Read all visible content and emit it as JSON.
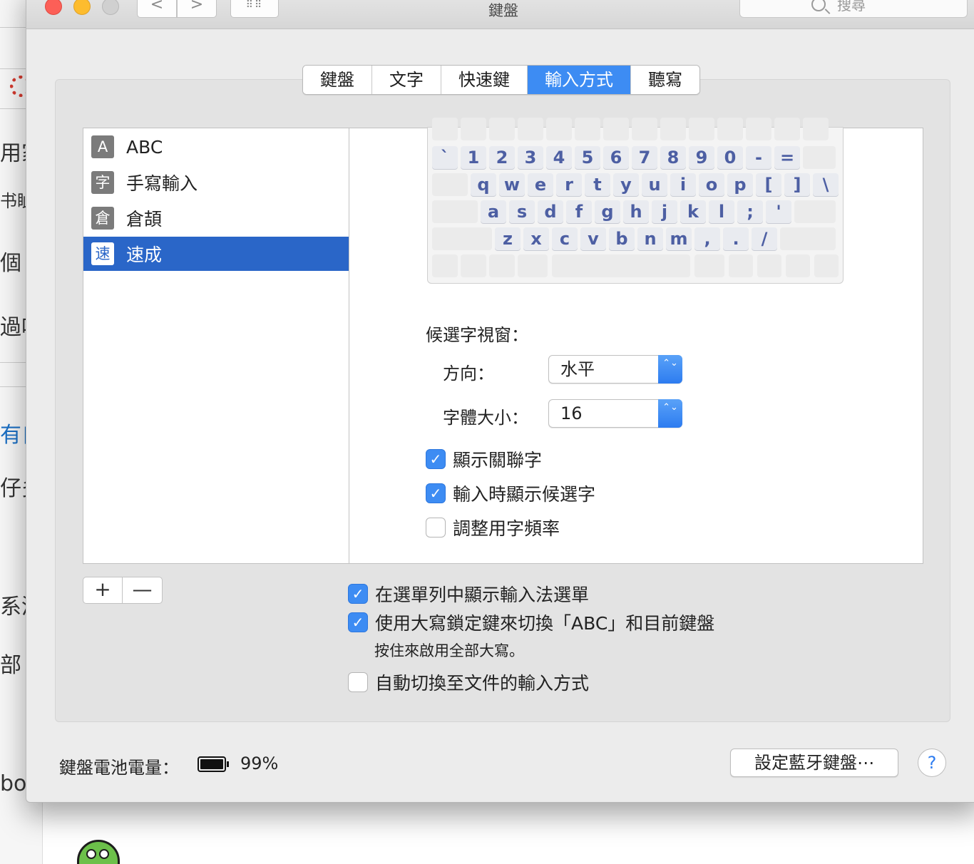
{
  "window": {
    "title": "鍵盤"
  },
  "toolbar": {
    "back_glyph": "<",
    "forward_glyph": ">",
    "grid_glyph": "⠿⠿",
    "search_placeholder": "搜尋"
  },
  "tabs": [
    {
      "label": "鍵盤"
    },
    {
      "label": "文字"
    },
    {
      "label": "快速鍵"
    },
    {
      "label": "輸入方式",
      "active": true
    },
    {
      "label": "聽寫"
    }
  ],
  "input_sources": [
    {
      "icon": "A",
      "label": "ABC"
    },
    {
      "icon": "字",
      "label": "手寫輸入"
    },
    {
      "icon": "倉",
      "label": "倉頡"
    },
    {
      "icon": "速",
      "label": "速成",
      "selected": true
    }
  ],
  "keyboard": {
    "rows": [
      [
        "`",
        "1",
        "2",
        "3",
        "4",
        "5",
        "6",
        "7",
        "8",
        "9",
        "0",
        "-",
        "="
      ],
      [
        "q",
        "w",
        "e",
        "r",
        "t",
        "y",
        "u",
        "i",
        "o",
        "p",
        "[",
        "]",
        "\\"
      ],
      [
        "a",
        "s",
        "d",
        "f",
        "g",
        "h",
        "j",
        "k",
        "l",
        ";",
        "'"
      ],
      [
        "z",
        "x",
        "c",
        "v",
        "b",
        "n",
        "m",
        ",",
        ".",
        "/"
      ]
    ]
  },
  "candidate": {
    "title": "候選字視窗：",
    "direction_label": "方向：",
    "direction_value": "水平",
    "font_size_label": "字體大小：",
    "font_size_value": "16"
  },
  "options": [
    {
      "label": "顯示關聯字",
      "checked": true
    },
    {
      "label": "輸入時顯示候選字",
      "checked": true
    },
    {
      "label": "調整用字頻率",
      "checked": false
    }
  ],
  "list_buttons": {
    "add": "+",
    "remove": "—"
  },
  "global_options": [
    {
      "label": "在選單列中顯示輸入法選單",
      "checked": true
    },
    {
      "label": "使用大寫鎖定鍵來切換「ABC」和目前鍵盤",
      "checked": true
    },
    {
      "label": "自動切換至文件的輸入方式",
      "checked": false
    }
  ],
  "caps_hint": "按住來啟用全部大寫。",
  "battery": {
    "label": "鍵盤電池電量：",
    "percent_text": "99%",
    "level": 0.99
  },
  "bluetooth_button": "設定藍牙鍵盤⋯",
  "help": "?",
  "check_glyph": "✓",
  "popup_arrows": "⌃⌄",
  "background_fragments": [
    "用家",
    "书眦",
    "個",
    "過吋",
    "有自",
    "仔多",
    "系清",
    "部",
    "bo"
  ],
  "colors": {
    "accent": "#3d8cf3",
    "selection": "#2a66c8",
    "key_text": "#4d5fa3"
  }
}
